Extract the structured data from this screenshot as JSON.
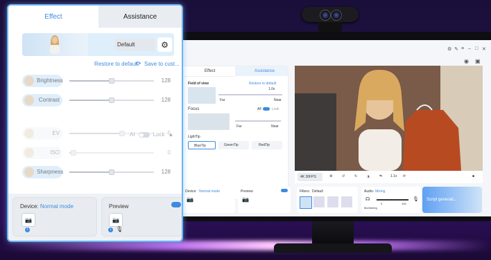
{
  "panel": {
    "tabs": [
      "Effect",
      "Assistance"
    ],
    "preset": "Default",
    "restore_label": "Restore to default",
    "save_label": "Save to cust...",
    "ai_label": "AI",
    "lock_label": "Lock",
    "sliders": [
      {
        "label": "Brightness",
        "value": "128",
        "level": 0.5
      },
      {
        "label": "Contrast",
        "value": "128",
        "level": 0.5
      },
      {
        "label": "EV",
        "value": "-5",
        "level": 0.62
      },
      {
        "label": "ISO",
        "value": "0",
        "level": 0.05
      },
      {
        "label": "Sharpness",
        "value": "128",
        "level": 0.5
      }
    ],
    "device_label": "Device:",
    "device_mode": "Normal mode",
    "preview_label": "Preview"
  },
  "screen": {
    "tabs": [
      "Effect",
      "Assistance"
    ],
    "fov_label": "Field of view",
    "fov_restore": "Restore to default",
    "fov_value": "1.0x",
    "far_label": "Far",
    "near_label": "Near",
    "focus_label": "Focus",
    "af_label": "AF",
    "lock_label": "Lock",
    "lighttip_label": "LightTip",
    "tips": [
      "BlueTip",
      "GreenTip",
      "RedTip"
    ],
    "resolution": "4K 30FPS",
    "zoom": "1.1x",
    "device_label": "Device:",
    "device_mode": "Normal mode",
    "preview_label": "Preview",
    "filters_label": "Filters:",
    "filters_value": "Default",
    "audio_label": "Audio:",
    "audio_value": "Mixing",
    "monitoring_label": "Monitoring",
    "audio_min": "0",
    "audio_max": "100",
    "script_label": "Script generati..."
  },
  "colors": {
    "accent": "#3d8be0",
    "panel_border": "#6cb4f2"
  }
}
